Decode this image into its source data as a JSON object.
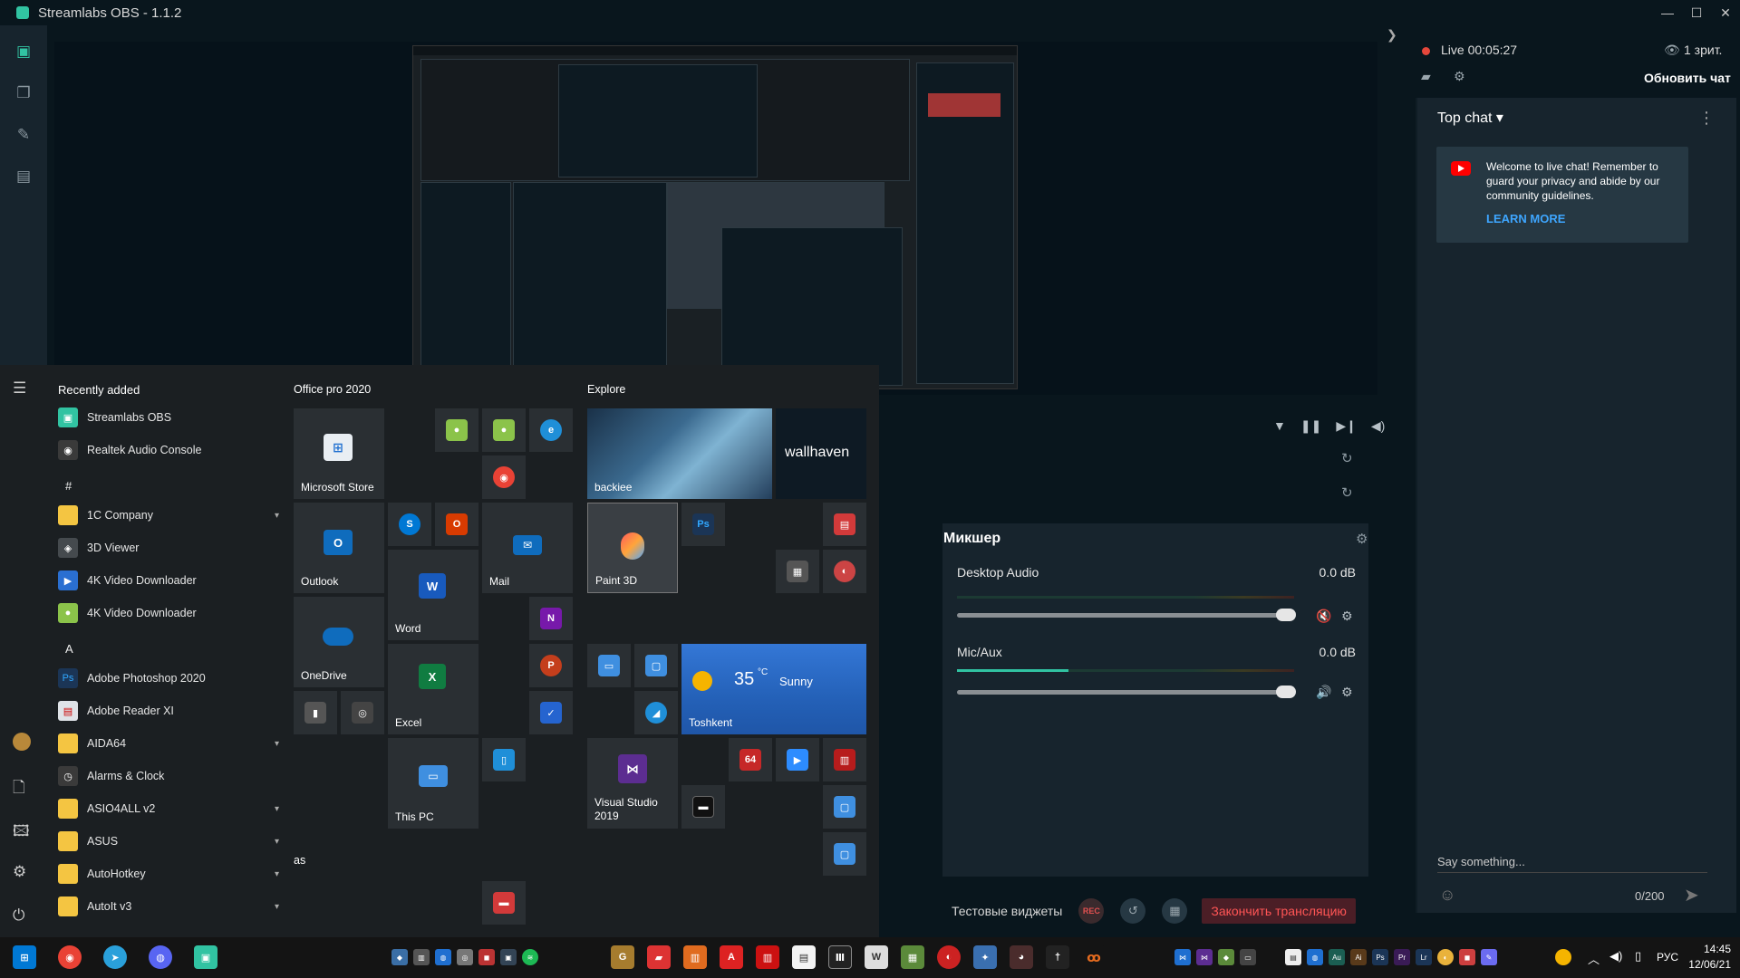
{
  "window": {
    "title": "Streamlabs OBS - 1.1.2",
    "minimize": "—",
    "maximize": "☐",
    "close": "✕"
  },
  "obs": {
    "mixer": {
      "title": "Микшер",
      "items": [
        {
          "name": "Desktop Audio",
          "db": "0.0 dB",
          "level": 0.0
        },
        {
          "name": "Mic/Aux",
          "db": "0.0 dB",
          "level": 0.33
        }
      ]
    },
    "bottom": {
      "widgets_label": "Тестовые виджеты",
      "rec_label": "REC",
      "end_stream": "Закончить трансляцию"
    }
  },
  "chat": {
    "live_label": "Live",
    "live_time": "00:05:27",
    "viewers": "1 зрит.",
    "refresh": "Обновить чат",
    "top_chat": "Top chat",
    "welcome": "Welcome to live chat! Remember to guard your privacy and abide by our community guidelines.",
    "learn_more": "LEARN MORE",
    "input_placeholder": "Say something...",
    "char_count": "0/200"
  },
  "start_menu": {
    "recently_added": "Recently added",
    "apps": {
      "streamlabs": "Streamlabs OBS",
      "realtek": "Realtek Audio Console",
      "hash": "#",
      "company": "1C Company",
      "viewer3d": "3D Viewer",
      "vd1": "4K Video Downloader",
      "vd2": "4K Video Downloader",
      "letter_a": "A",
      "photoshop": "Adobe Photoshop 2020",
      "reader": "Adobe Reader XI",
      "aida": "AIDA64",
      "alarms": "Alarms & Clock",
      "asio": "ASIO4ALL v2",
      "asus": "ASUS",
      "autohotkey": "AutoHotkey",
      "autoit": "AutoIt v3"
    },
    "groups": {
      "office": "Office pro 2020",
      "explore": "Explore",
      "as": "as"
    },
    "tiles": {
      "store": "Microsoft Store",
      "outlook": "Outlook",
      "mail": "Mail",
      "word": "Word",
      "onedrive": "OneDrive",
      "excel": "Excel",
      "thispc": "This PC",
      "backiee": "backiee",
      "wallhaven": "wallhaven",
      "paint3d": "Paint 3D",
      "ps": "Ps",
      "temp": "35",
      "temp_unit": "°C",
      "condition": "Sunny",
      "city": "Toshkent",
      "vs": "Visual Studio 2019",
      "aida_tile": "64"
    }
  },
  "taskbar": {
    "lang": "РУС",
    "time": "14:45",
    "date": "12/06/21"
  }
}
